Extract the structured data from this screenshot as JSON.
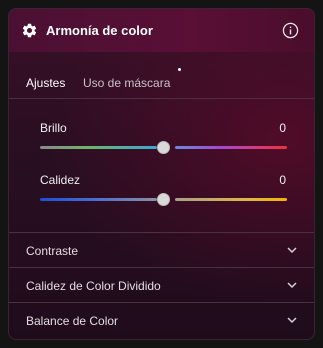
{
  "panel": {
    "title": "Armonía de color",
    "icons": {
      "settings": "gear-icon",
      "info": "info-icon"
    }
  },
  "tabs": [
    {
      "label": "Ajustes",
      "active": true
    },
    {
      "label": "Uso de máscara",
      "active": false,
      "indicator": "dot"
    }
  ],
  "sliders": [
    {
      "label": "Brillo",
      "value": "0",
      "position": 0.5
    },
    {
      "label": "Calidez",
      "value": "0",
      "position": 0.5
    }
  ],
  "sections": [
    {
      "label": "Contraste"
    },
    {
      "label": "Calidez de Color Dividido"
    },
    {
      "label": "Balance de Color"
    }
  ],
  "colors": {
    "header": "#5a0f35",
    "background": "#2a0e22",
    "brightness_gradient": [
      "#7a7a7a",
      "#4caf50",
      "#2196f3",
      "#9c27b0",
      "#e91e63",
      "#f44336"
    ],
    "warmth_gradient": [
      "#1e4fd8",
      "#5a7ad0",
      "#9a9a9a",
      "#d6b84a",
      "#f5b400"
    ]
  }
}
